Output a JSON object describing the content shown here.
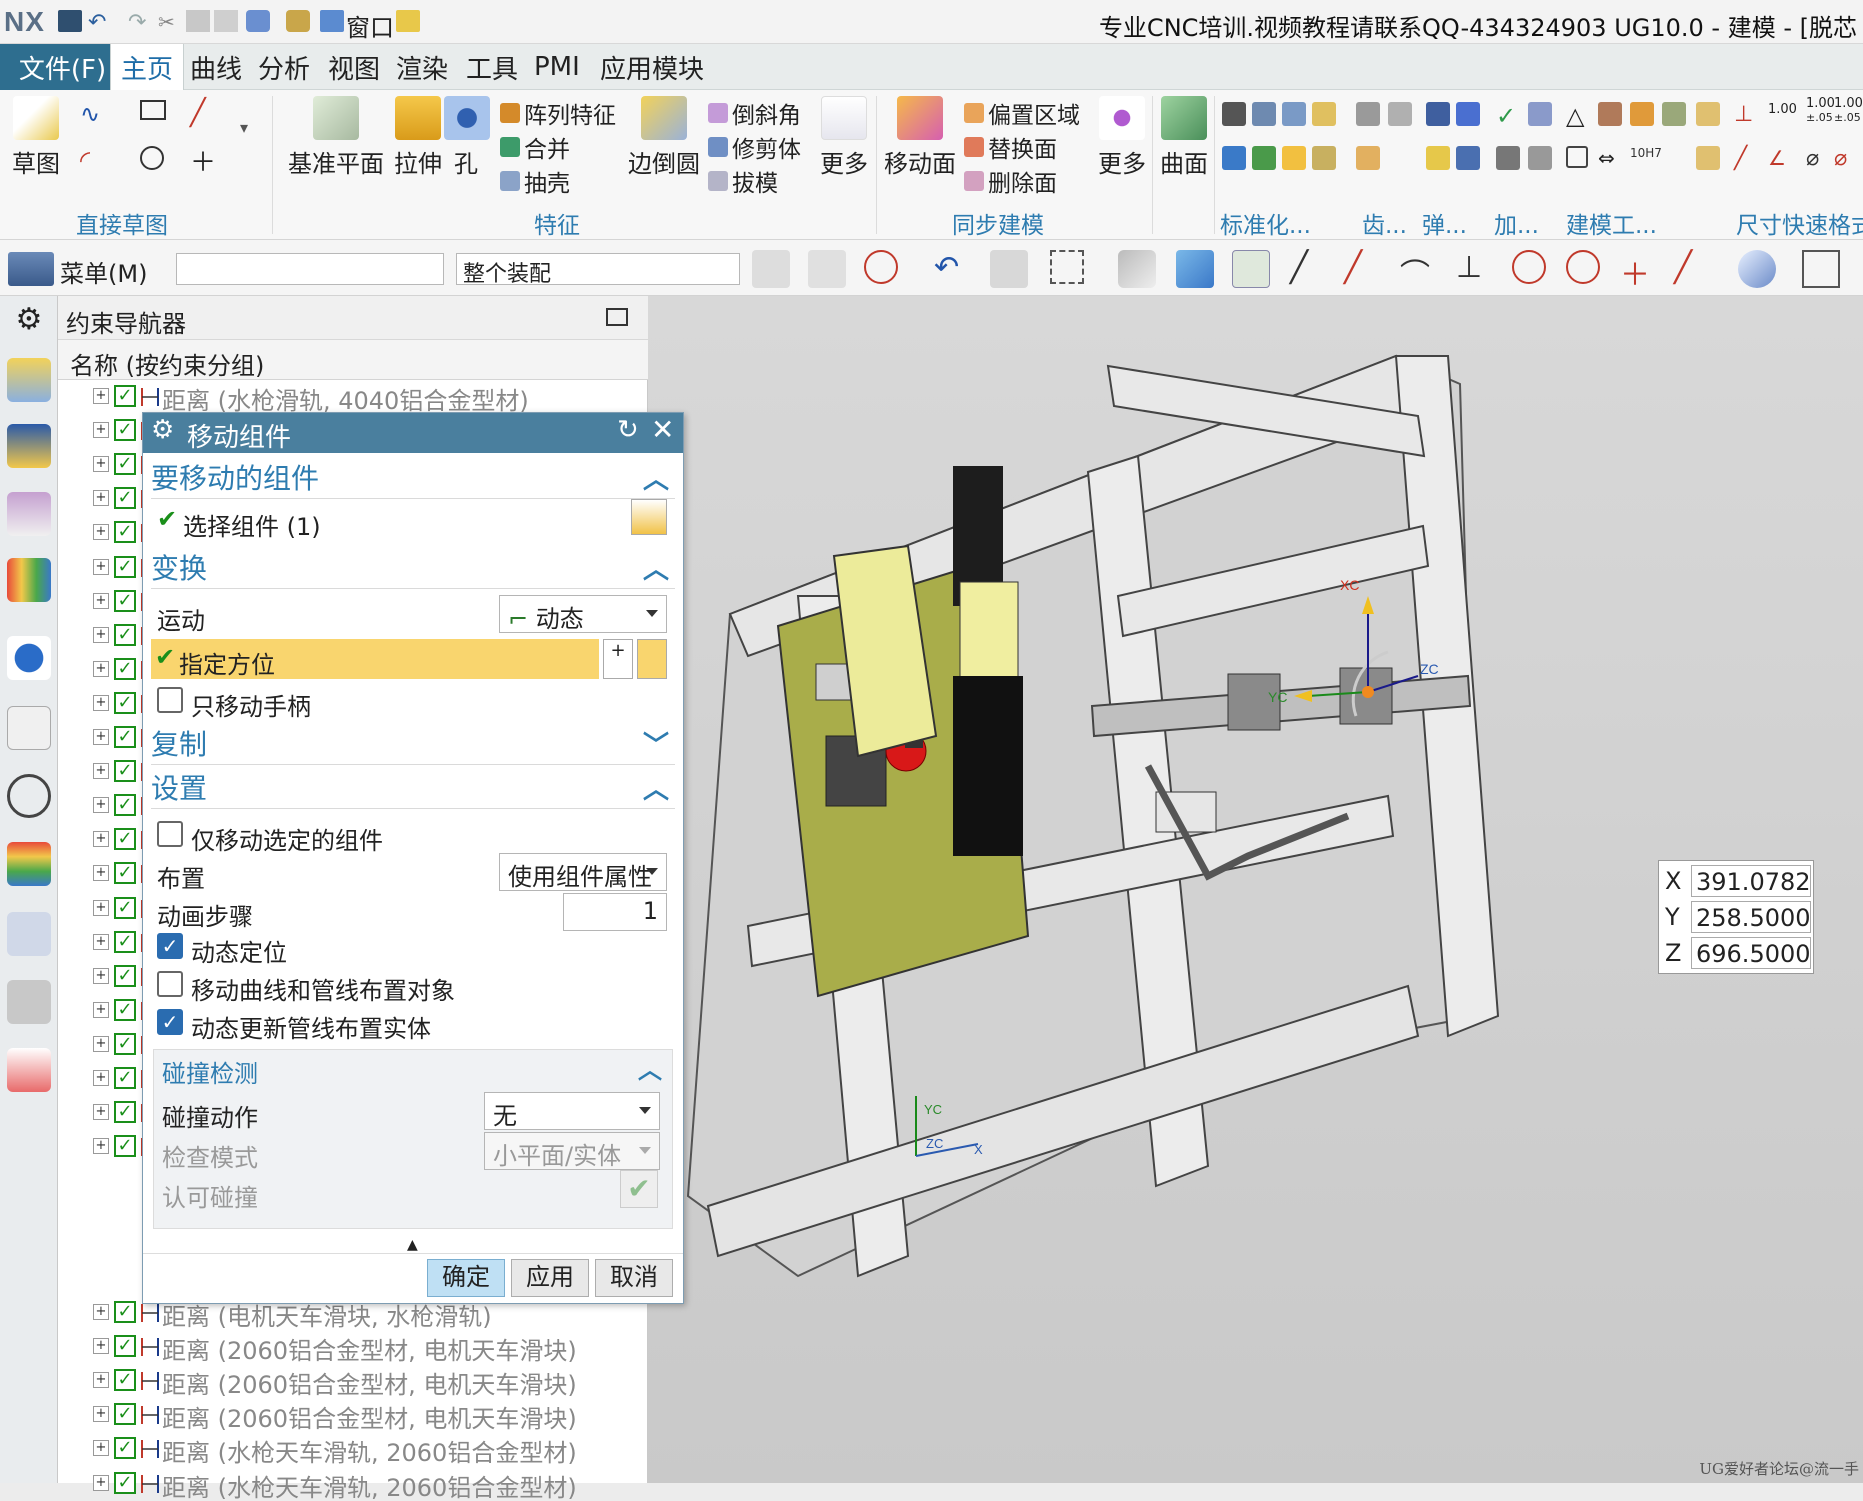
{
  "app": {
    "logo": "NX",
    "window_title": "专业CNC培训.视频教程请联系QQ-434324903 UG10.0 - 建模 - [脱芯",
    "window_menu_label": "窗口"
  },
  "menubar": {
    "file": "文件(F)",
    "tabs": [
      "主页",
      "曲线",
      "分析",
      "视图",
      "渲染",
      "工具",
      "PMI",
      "应用模块"
    ]
  },
  "ribbon": {
    "sketch": "草图",
    "groups": {
      "direct_sketch": "直接草图",
      "feature": "特征",
      "sync": "同步建模",
      "standard": "标准化...",
      "gear": "齿...",
      "spring": "弹...",
      "add": "加...",
      "tools": "建模工...",
      "dim": "尺寸快速格式"
    },
    "datum_plane": "基准平面",
    "extrude": "拉伸",
    "hole": "孔",
    "pattern": "阵列特征",
    "unite": "合并",
    "shell": "抽壳",
    "edge_blend": "边倒圆",
    "chamfer": "倒斜角",
    "trim": "修剪体",
    "draft": "拔模",
    "more1": "更多",
    "move_face": "移动面",
    "offset_region": "偏置区域",
    "replace_face": "替换面",
    "delete_face": "删除面",
    "more2": "更多",
    "surface": "曲面",
    "tol_100": "1.00",
    "tol_105": "1.00",
    "tol_105_sub": "±.05",
    "tol_100b": "1.00",
    "tol_100b_sub": "±.05",
    "fit_code": "10H7"
  },
  "toolbar2": {
    "menu": "菜单(M)",
    "filter_value": "",
    "scope": "整个装配"
  },
  "navigator": {
    "title": "约束导航器",
    "column": "名称 (按约束分组)",
    "rows_top": [
      "距离 (水枪滑轨, 4040铝合金型材)"
    ],
    "rows_bottom": [
      "距离 (电机天车滑块, 水枪滑轨)",
      "距离 (2060铝合金型材, 电机天车滑块)",
      "距离 (2060铝合金型材, 电机天车滑块)",
      "距离 (2060铝合金型材, 电机天车滑块)",
      "距离 (水枪天车滑轨, 2060铝合金型材)",
      "距离 (水枪天车滑轨, 2060铝合金型材)"
    ]
  },
  "dialog": {
    "title": "移动组件",
    "sec_components": "要移动的组件",
    "select_component": "选择组件 (1)",
    "sec_transform": "变换",
    "motion_label": "运动",
    "motion_value": "动态",
    "specify_orientation": "指定方位",
    "move_handle_only": "只移动手柄",
    "sec_copy": "复制",
    "sec_settings": "设置",
    "move_selected_only": "仅移动选定的组件",
    "layout_label": "布置",
    "layout_value": "使用组件属性",
    "anim_steps_label": "动画步骤",
    "anim_steps_value": "1",
    "dynamic_position": "动态定位",
    "move_curves": "移动曲线和管线布置对象",
    "dynamic_update": "动态更新管线布置实体",
    "sec_collision": "碰撞检测",
    "collision_action_label": "碰撞动作",
    "collision_action_value": "无",
    "check_mode_label": "检查模式",
    "check_mode_value": "小平面/实体",
    "accept_collision_label": "认可碰撞",
    "ok": "确定",
    "apply": "应用",
    "cancel": "取消"
  },
  "viewport": {
    "coords": {
      "x_label": "X",
      "x": "391.0782",
      "y_label": "Y",
      "y": "258.5000",
      "z_label": "Z",
      "z": "696.5000"
    },
    "handle_labels": {
      "xc": "XC",
      "yc": "YC",
      "zc": "ZC"
    },
    "wcs_labels": {
      "yc": "YC",
      "zc": "ZC",
      "x": "X"
    },
    "watermark": "UG爱好者论坛@流一手"
  },
  "colors": {
    "accent": "#2e7cb0",
    "file_menu": "#2e6e8f",
    "dialog_title": "#4a7f9e",
    "highlight": "#f9d56e",
    "frame": "#e6e6e6"
  }
}
